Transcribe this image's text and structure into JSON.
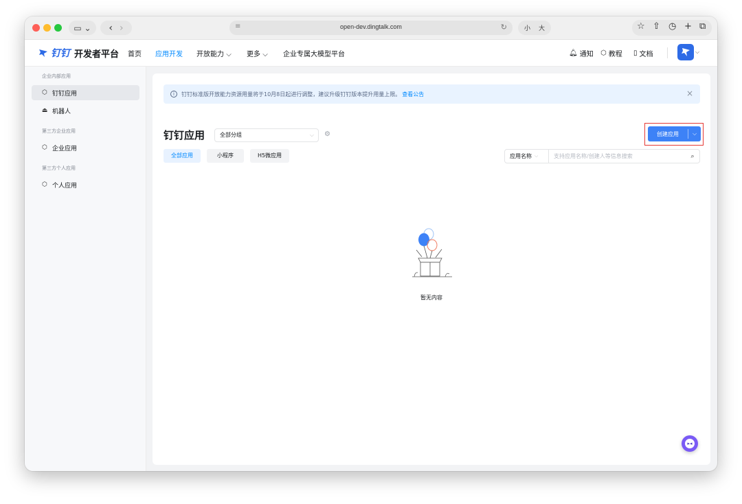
{
  "browser": {
    "url": "open-dev.dingtalk.com",
    "zoom_small": "小",
    "zoom_large": "大"
  },
  "header": {
    "logo_brand": "钉钉",
    "logo_title": "开发者平台",
    "nav": [
      {
        "label": "首页"
      },
      {
        "label": "应用开发"
      },
      {
        "label": "开放能力"
      },
      {
        "label": "更多"
      },
      {
        "label": "企业专属大模型平台"
      }
    ],
    "notify": "通知",
    "tutorial": "教程",
    "docs": "文档"
  },
  "sidebar": {
    "groups": [
      {
        "label": "企业内部应用"
      },
      {
        "label": "第三方企业应用"
      },
      {
        "label": "第三方个人应用"
      }
    ],
    "items": [
      {
        "label": "钉钉应用"
      },
      {
        "label": "机器人"
      },
      {
        "label": "企业应用"
      },
      {
        "label": "个人应用"
      }
    ]
  },
  "main": {
    "notice_text": "钉钉标准版开放能力资源用量将于10月8日起进行调整，建议升级钉钉版本提升用量上限。",
    "notice_link": "查看公告",
    "title": "钉钉应用",
    "group_select": "全部分组",
    "create_button": "创建应用",
    "tabs": [
      {
        "label": "全部应用"
      },
      {
        "label": "小程序"
      },
      {
        "label": "H5微应用"
      }
    ],
    "search_field": "应用名称",
    "search_placeholder": "支持应用名称/创建人等信息搜索",
    "empty_text": "暂无内容"
  },
  "colors": {
    "accent": "#0089ff",
    "button": "#3d82f7",
    "highlight_outline": "#e53935"
  }
}
